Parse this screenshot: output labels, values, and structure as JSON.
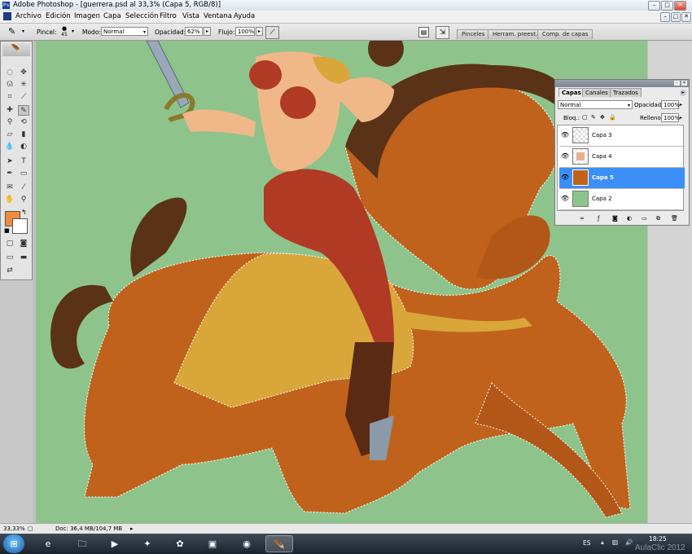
{
  "window": {
    "app_icon": "Ps",
    "title": "Adobe Photoshop - [guerrera.psd al 33,3% (Capa 5, RGB/8)]",
    "controls": {
      "minimize": "–",
      "restore": "□",
      "close": "✕"
    }
  },
  "menu": [
    "Archivo",
    "Edición",
    "Imagen",
    "Capa",
    "Selección",
    "Filtro",
    "Vista",
    "Ventana",
    "Ayuda"
  ],
  "doc_controls": {
    "minimize": "–",
    "restore": "□",
    "close": "✕"
  },
  "options_bar": {
    "brush_label": "Pincel:",
    "brush_size": "45",
    "mode_label": "Modo:",
    "mode_value": "Normal",
    "opacity_label": "Opacidad:",
    "opacity_value": "62%",
    "flow_label": "Flujo:",
    "flow_value": "100%",
    "well_tabs": [
      "Pinceles",
      "Herram. preest.",
      "Comp. de capas"
    ]
  },
  "toolbox": {
    "foreground_color": "#f08a3c",
    "background_color": "#ffffff"
  },
  "layers_panel": {
    "tabs": [
      "Capas",
      "Canales",
      "Trazados"
    ],
    "blend_mode": "Normal",
    "opacity_label": "Opacidad:",
    "opacity_value": "100%",
    "lock_label": "Bloq.:",
    "fill_label": "Relleno:",
    "fill_value": "100%",
    "layers": [
      {
        "name": "Capa 3",
        "selected": false
      },
      {
        "name": "Capa 4",
        "selected": false
      },
      {
        "name": "Capa 5",
        "selected": true
      },
      {
        "name": "Capa 2",
        "selected": false
      }
    ]
  },
  "status_bar": {
    "zoom": "33,33%",
    "doc_info": "Doc: 36,4 MB/104,7 MB"
  },
  "taskbar": {
    "language": "ES",
    "time": "18:25",
    "watermark": "AulaClic 2012"
  },
  "colors": {
    "canvas_bg": "#8ec48c",
    "selection_highlight": "#3b8ff7",
    "horse": "#c0621c",
    "cloth": "#d9a63a"
  }
}
